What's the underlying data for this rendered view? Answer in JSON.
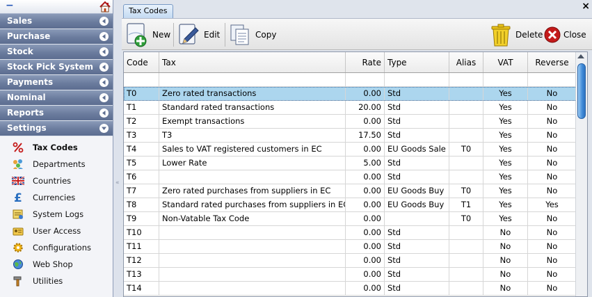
{
  "sidebar": {
    "collapse_label": "−",
    "groups": [
      {
        "label": "Sales",
        "icon": "chevron-left-icon"
      },
      {
        "label": "Purchase",
        "icon": "chevron-left-icon"
      },
      {
        "label": "Stock",
        "icon": "chevron-left-icon"
      },
      {
        "label": "Stock Pick System",
        "icon": "chevron-left-icon"
      },
      {
        "label": "Payments",
        "icon": "chevron-left-icon"
      },
      {
        "label": "Nominal",
        "icon": "chevron-left-icon"
      },
      {
        "label": "Reports",
        "icon": "chevron-left-icon"
      },
      {
        "label": "Settings",
        "icon": "chevron-down-icon"
      }
    ],
    "settings_items": [
      {
        "label": "Tax Codes",
        "icon": "percent-icon",
        "active": true
      },
      {
        "label": "Departments",
        "icon": "departments-icon"
      },
      {
        "label": "Countries",
        "icon": "uk-flag-icon"
      },
      {
        "label": "Currencies",
        "icon": "pound-icon"
      },
      {
        "label": "System Logs",
        "icon": "logs-icon"
      },
      {
        "label": "User Access",
        "icon": "user-access-icon"
      },
      {
        "label": "Configurations",
        "icon": "gear-icon"
      },
      {
        "label": "Web Shop",
        "icon": "globe-icon"
      },
      {
        "label": "Utilities",
        "icon": "hammer-icon"
      }
    ]
  },
  "tab": {
    "label": "Tax Codes"
  },
  "window": {
    "close_label": "×"
  },
  "toolbar": {
    "new_label": "New",
    "edit_label": "Edit",
    "copy_label": "Copy",
    "delete_label": "Delete",
    "close_label": "Close"
  },
  "grid": {
    "columns": [
      "Code",
      "Tax",
      "Rate",
      "Type",
      "Alias",
      "VAT",
      "Reverse"
    ],
    "rows": [
      {
        "code": "T0",
        "tax": "Zero rated transactions",
        "rate": "0.00",
        "type": "Std",
        "alias": "",
        "vat": "Yes",
        "reverse": "No",
        "selected": true
      },
      {
        "code": "T1",
        "tax": "Standard rated transactions",
        "rate": "20.00",
        "type": "Std",
        "alias": "",
        "vat": "Yes",
        "reverse": "No"
      },
      {
        "code": "T2",
        "tax": "Exempt transactions",
        "rate": "0.00",
        "type": "Std",
        "alias": "",
        "vat": "Yes",
        "reverse": "No"
      },
      {
        "code": "T3",
        "tax": "T3",
        "rate": "17.50",
        "type": "Std",
        "alias": "",
        "vat": "Yes",
        "reverse": "No"
      },
      {
        "code": "T4",
        "tax": "Sales to VAT registered customers in EC",
        "rate": "0.00",
        "type": "EU Goods Sale",
        "alias": "T0",
        "vat": "Yes",
        "reverse": "No"
      },
      {
        "code": "T5",
        "tax": "Lower Rate",
        "rate": "5.00",
        "type": "Std",
        "alias": "",
        "vat": "Yes",
        "reverse": "No"
      },
      {
        "code": "T6",
        "tax": "",
        "rate": "0.00",
        "type": "Std",
        "alias": "",
        "vat": "Yes",
        "reverse": "No"
      },
      {
        "code": "T7",
        "tax": "Zero rated purchases from suppliers in EC",
        "rate": "0.00",
        "type": "EU Goods Buy",
        "alias": "T0",
        "vat": "Yes",
        "reverse": "No"
      },
      {
        "code": "T8",
        "tax": "Standard rated purchases from suppliers in EC",
        "rate": "0.00",
        "type": "EU Goods Buy",
        "alias": "T1",
        "vat": "Yes",
        "reverse": "Yes"
      },
      {
        "code": "T9",
        "tax": "Non-Vatable Tax Code",
        "rate": "0.00",
        "type": "",
        "alias": "T0",
        "vat": "Yes",
        "reverse": "No"
      },
      {
        "code": "T10",
        "tax": "",
        "rate": "0.00",
        "type": "Std",
        "alias": "",
        "vat": "No",
        "reverse": "No"
      },
      {
        "code": "T11",
        "tax": "",
        "rate": "0.00",
        "type": "Std",
        "alias": "",
        "vat": "No",
        "reverse": "No"
      },
      {
        "code": "T12",
        "tax": "",
        "rate": "0.00",
        "type": "Std",
        "alias": "",
        "vat": "No",
        "reverse": "No"
      },
      {
        "code": "T13",
        "tax": "",
        "rate": "0.00",
        "type": "Std",
        "alias": "",
        "vat": "No",
        "reverse": "No"
      },
      {
        "code": "T14",
        "tax": "",
        "rate": "0.00",
        "type": "Std",
        "alias": "",
        "vat": "No",
        "reverse": "No"
      }
    ]
  },
  "colors": {
    "group_header": "#6b7c9e",
    "selected_row": "#acd6ee",
    "tab_border": "#7a9ac4"
  }
}
